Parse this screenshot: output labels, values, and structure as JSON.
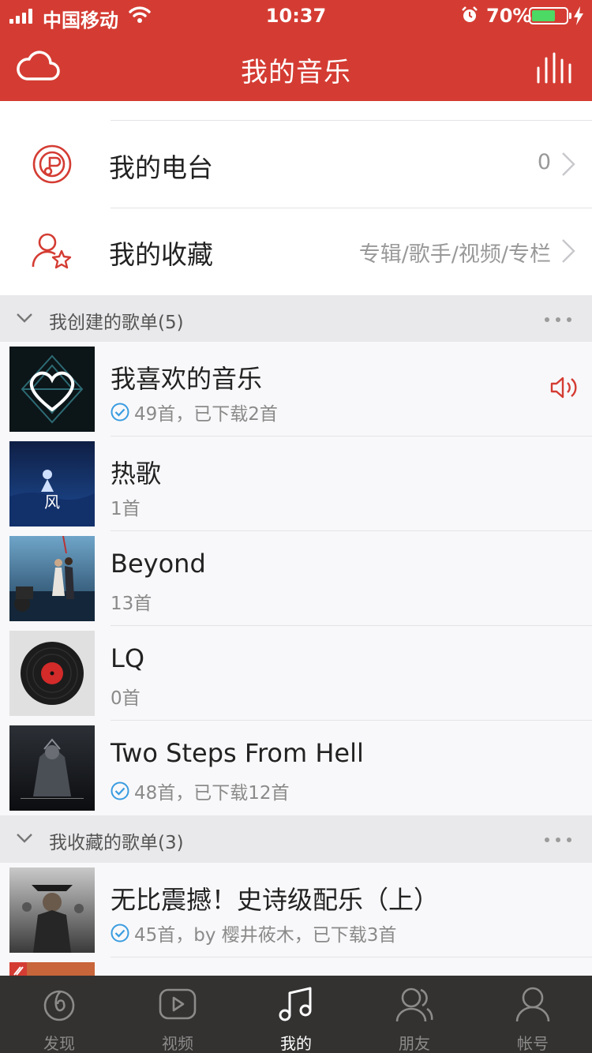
{
  "status_bar": {
    "carrier": "中国移动",
    "time": "10:37",
    "battery_pct": "70%",
    "battery_level": 0.7
  },
  "header": {
    "title": "我的音乐",
    "left_icon": "cloud-icon",
    "right_icon": "equalizer-icon"
  },
  "features": [
    {
      "label": "我的电台",
      "value": "0",
      "icon": "radio-icon"
    },
    {
      "label": "我的收藏",
      "value": "专辑/歌手/视频/专栏",
      "icon": "user-star-icon"
    }
  ],
  "created_section": {
    "title": "我创建的歌单(5)"
  },
  "created_playlists": [
    {
      "name": "我喜欢的音乐",
      "meta": "49首，已下载2首",
      "downloaded": true,
      "playing": true
    },
    {
      "name": "热歌",
      "meta": "1首",
      "downloaded": false,
      "playing": false
    },
    {
      "name": "Beyond",
      "meta": "13首",
      "downloaded": false,
      "playing": false
    },
    {
      "name": "LQ",
      "meta": "0首",
      "downloaded": false,
      "playing": false
    },
    {
      "name": "Two Steps From Hell",
      "meta": "48首，已下载12首",
      "downloaded": true,
      "playing": false
    }
  ],
  "collected_section": {
    "title": "我收藏的歌单(3)"
  },
  "collected_playlists": [
    {
      "name": "无比震撼！史诗级配乐（上）",
      "meta": "45首，by 樱井莜木，已下载3首",
      "downloaded": true
    }
  ],
  "tabs": [
    {
      "label": "发现",
      "icon": "discover-icon",
      "active": false
    },
    {
      "label": "视频",
      "icon": "video-icon",
      "active": false
    },
    {
      "label": "我的",
      "icon": "music-note-icon",
      "active": true
    },
    {
      "label": "朋友",
      "icon": "friends-icon",
      "active": false
    },
    {
      "label": "帐号",
      "icon": "account-icon",
      "active": false
    }
  ],
  "colors": {
    "brand_red": "#d43c33",
    "tabbar_bg": "#333231",
    "check_blue": "#3a9ce0"
  }
}
